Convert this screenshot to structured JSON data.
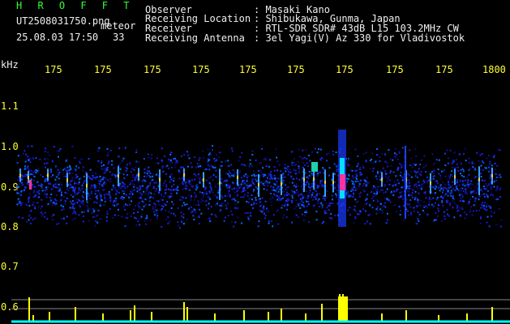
{
  "header": {
    "app_name": "H R O F F T",
    "file_name": "UT2508031750.png",
    "mode": "meteor",
    "date_time": "25.08.03 17:50",
    "count": "33"
  },
  "info": {
    "observer_label": "Observer",
    "observer_value": ": Masaki Kano",
    "location_label": "Receiving Location",
    "location_value": ": Shibukawa, Gunma, Japan",
    "receiver_label": "Receiver",
    "receiver_value": ": RTL-SDR SDR# 43dB L15 103.2MHz CW",
    "antenna_label": "Receiving Antenna",
    "antenna_value": ": 3el Yagi(V) Az 330 for Vladivostok"
  },
  "time_axis": {
    "ticks": [
      "175",
      "175",
      "175",
      "175",
      "175",
      "175",
      "175",
      "175",
      "175",
      "1800"
    ]
  },
  "freq_axis": {
    "unit": "kHz",
    "ticks": [
      "1.1",
      "1.0",
      "0.9",
      "0.8",
      "0.7",
      "0.6"
    ]
  },
  "colors": {
    "background": "#000000",
    "label_text": "#f0f0f0",
    "tick_text": "#ffff33",
    "app_name": "#33ff33",
    "histogram": "#ffff00",
    "baseline": "#00ffff"
  }
}
